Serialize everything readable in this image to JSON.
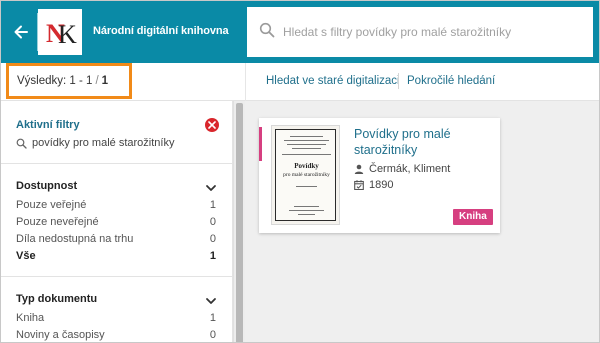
{
  "header": {
    "site_title": "Národní digitální knihovna",
    "logo_text": "NK",
    "search": {
      "placeholder": "Hledat s filtry povídky pro malé starožitníky",
      "value": ""
    }
  },
  "results": {
    "label": "Výsledky:",
    "range": "1 - 1",
    "separator": "/",
    "total": "1"
  },
  "toolbar": {
    "old_digitization_link": "Hledat ve staré digitalizaci",
    "advanced_search_link": "Pokročilé hledání"
  },
  "sidebar": {
    "active_filters": {
      "title": "Aktivní filtry",
      "query": "povídky pro malé starožitníky"
    },
    "facets": [
      {
        "title": "Dostupnost",
        "items": [
          {
            "label": "Pouze veřejné",
            "count": "1"
          },
          {
            "label": "Pouze neveřejné",
            "count": "0"
          },
          {
            "label": "Díla nedostupná na trhu",
            "count": "0"
          },
          {
            "label": "Vše",
            "count": "1"
          }
        ]
      },
      {
        "title": "Typ dokumentu",
        "items": [
          {
            "label": "Kniha",
            "count": "1"
          },
          {
            "label": "Noviny a časopisy",
            "count": "0"
          }
        ]
      }
    ]
  },
  "results_list": [
    {
      "title": "Povídky pro malé starožitníky",
      "author": "Čermák, Kliment",
      "year": "1890",
      "doc_type": "Kniha",
      "thumbnail": {
        "title_word": "Povídky",
        "subtitle": "pro malé starožitníky"
      }
    }
  ],
  "colors": {
    "header_bg": "#0a8aa6",
    "link": "#1f6f8b",
    "highlight_border": "#f18a18",
    "badge": "#d63f80",
    "clear_button": "#d9262c"
  }
}
